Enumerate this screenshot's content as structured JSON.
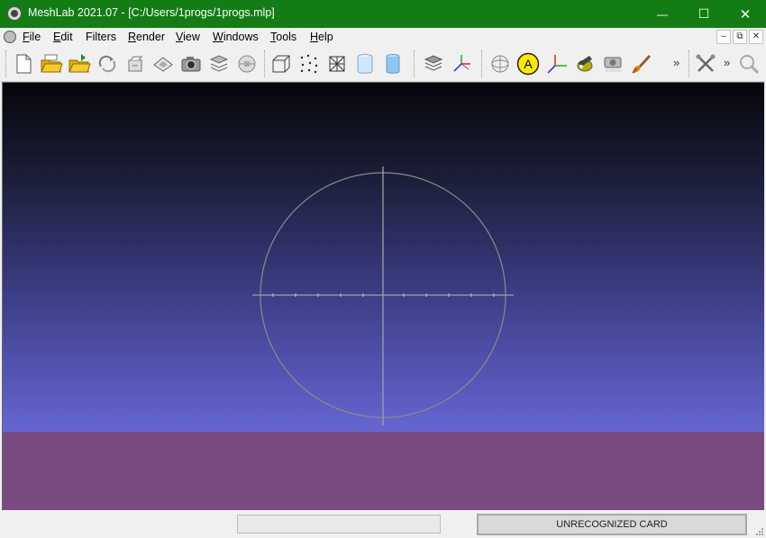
{
  "window": {
    "title": "MeshLab 2021.07 - [C:/Users/1progs/1progs.mlp]",
    "controls": {
      "minimize": "—",
      "maximize": "☐",
      "close": "✕"
    }
  },
  "menubar": {
    "items": [
      {
        "label": "File",
        "accel": "F",
        "rest": "ile"
      },
      {
        "label": "Edit",
        "accel": "E",
        "rest": "dit"
      },
      {
        "label": "Filters",
        "accel": "",
        "rest": "Filters"
      },
      {
        "label": "Render",
        "accel": "R",
        "rest": "ender"
      },
      {
        "label": "View",
        "accel": "V",
        "rest": "iew"
      },
      {
        "label": "Windows",
        "accel": "W",
        "rest": "indows"
      },
      {
        "label": "Tools",
        "accel": "T",
        "rest": "ools"
      },
      {
        "label": "Help",
        "accel": "H",
        "rest": "elp"
      }
    ],
    "mdi": {
      "minimize": "–",
      "restore": "⧉",
      "close": "✕"
    }
  },
  "toolbar": {
    "more1": "»",
    "more2": "»",
    "icons": [
      "new-project-icon",
      "open-project-icon",
      "import-mesh-icon",
      "reload-icon",
      "reload-all-icon",
      "export-mesh-icon",
      "snapshot-icon",
      "layers-icon",
      "show-layer-icon",
      "bbox-icon",
      "points-icon",
      "wireframe-icon",
      "flat-icon",
      "smooth-icon",
      "raster-layers-icon",
      "axes-icon",
      "manipulator-icon",
      "annotate-icon",
      "align-axes-icon",
      "paint-bucket-icon",
      "raster-align-icon",
      "paint-brush-icon",
      "tools-icon",
      "search-icon"
    ]
  },
  "viewport": {
    "sky_top_color": "#05060b",
    "sky_bottom_color": "#6566d2",
    "floor_color": "#7a4b80",
    "trackball_color": "#8a8a8a"
  },
  "statusbar": {
    "card_label": "UNRECOGNIZED CARD"
  }
}
